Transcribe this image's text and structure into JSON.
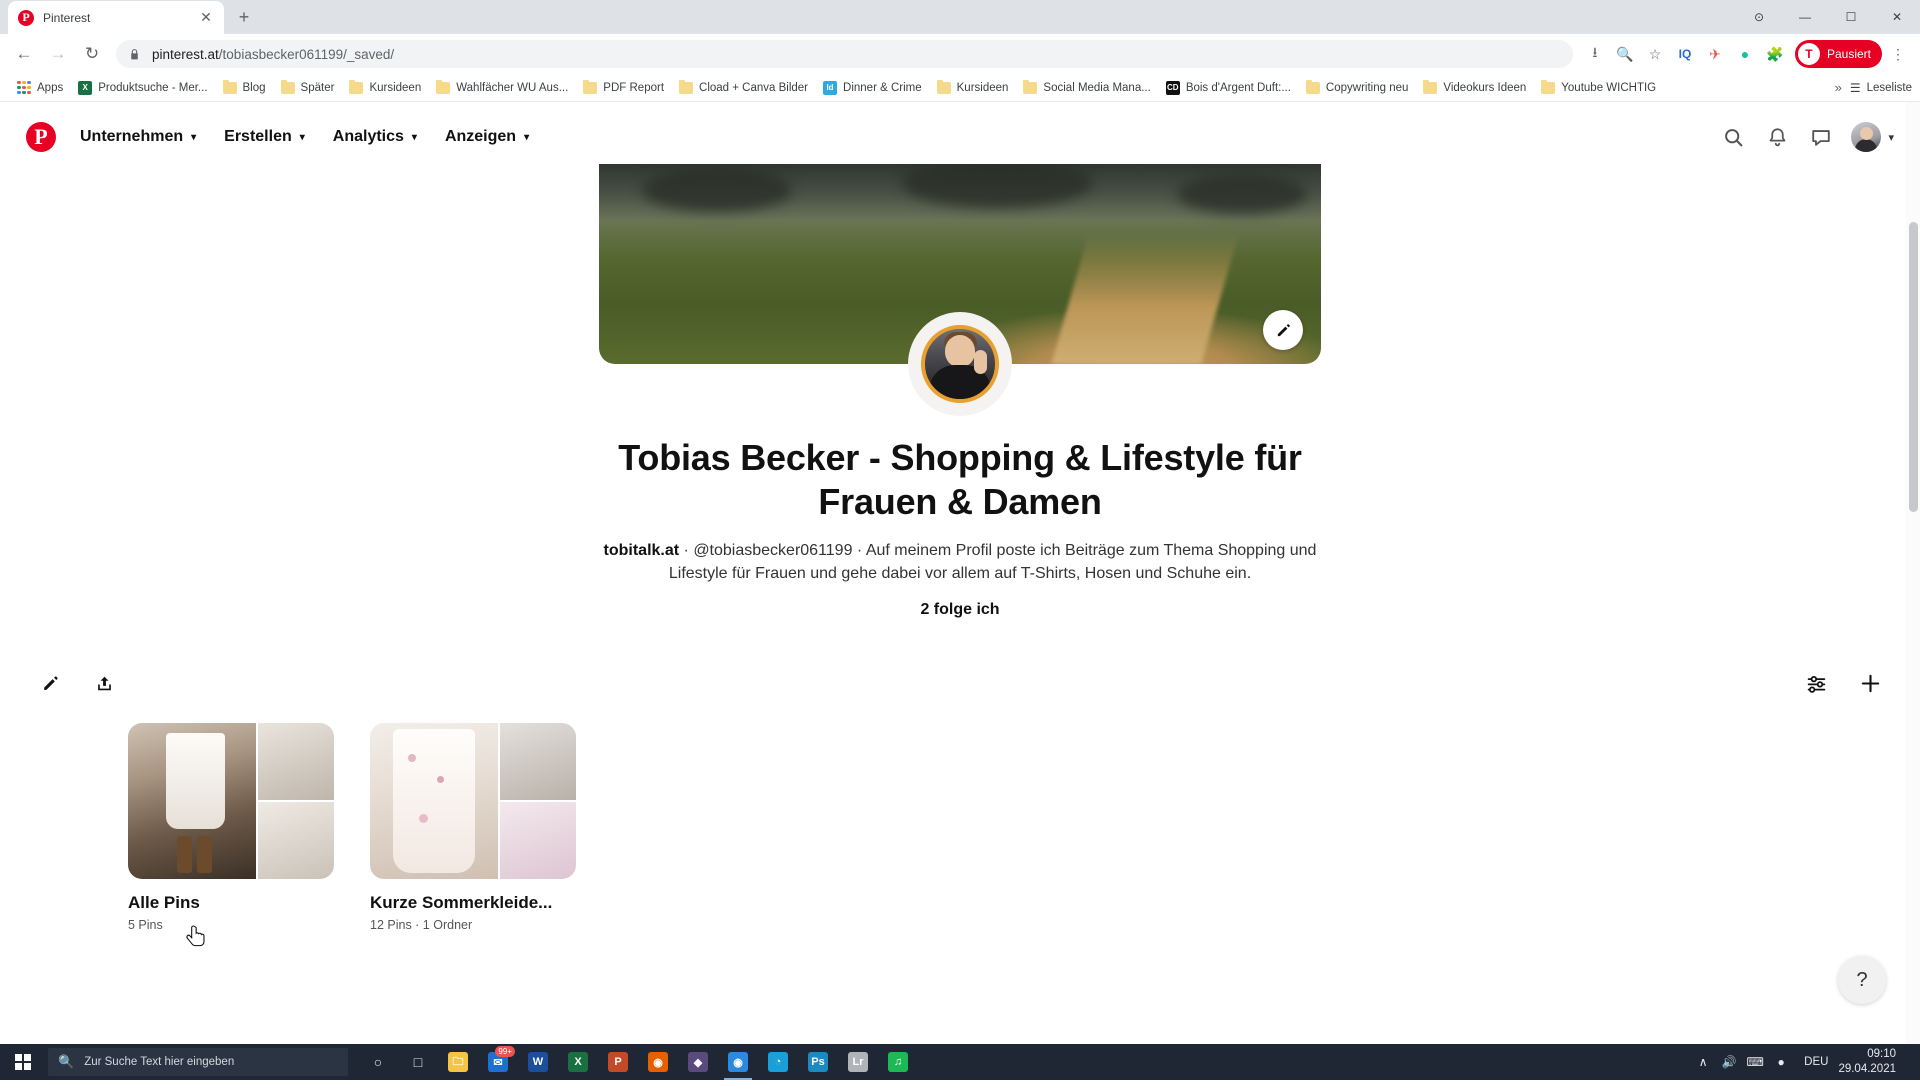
{
  "browser": {
    "tab": {
      "title": "Pinterest",
      "favicon": "pinterest-icon",
      "close_label": "✕"
    },
    "new_tab_label": "+",
    "window_controls": {
      "minimize": "—",
      "maximize": "☐",
      "close": "✕",
      "extra": "⊙"
    },
    "nav": {
      "back": "←",
      "forward": "→",
      "reload": "↻"
    },
    "omnibox": {
      "url_bold": "pinterest.at",
      "url_rest": "/tobiasbecker061199/_saved/",
      "full_url": "pinterest.at/tobiasbecker061199/_saved/",
      "lock_icon": "lock-icon"
    },
    "toolbar_icons": [
      "install-icon",
      "zoom-icon",
      "bookmark-star-icon",
      "iq-extension-icon",
      "extension-icon",
      "grammarly-icon",
      "puzzle-extension-icon"
    ],
    "profile": {
      "initial": "T",
      "label": "Pausiert"
    },
    "menu_icon": "⋮",
    "bookmarks": [
      {
        "label": "Apps",
        "icon": "apps-grid-icon"
      },
      {
        "label": "Produktsuche - Mer...",
        "icon": "excel-icon",
        "color": "#1a7040",
        "glyph": "X"
      },
      {
        "label": "Blog",
        "icon": "folder-icon"
      },
      {
        "label": "Später",
        "icon": "folder-icon"
      },
      {
        "label": "Kursideen",
        "icon": "folder-icon"
      },
      {
        "label": "Wahlfächer WU Aus...",
        "icon": "folder-icon"
      },
      {
        "label": "PDF Report",
        "icon": "folder-icon"
      },
      {
        "label": "Cload + Canva Bilder",
        "icon": "folder-icon"
      },
      {
        "label": "Dinner & Crime",
        "icon": "indesign-icon",
        "color": "#2eaadc",
        "glyph": "Id"
      },
      {
        "label": "Kursideen",
        "icon": "folder-icon"
      },
      {
        "label": "Social Media Mana...",
        "icon": "folder-icon"
      },
      {
        "label": "Bois d'Argent Duft:...",
        "icon": "dior-icon",
        "color": "#111111",
        "glyph": "CD"
      },
      {
        "label": "Copywriting neu",
        "icon": "folder-icon"
      },
      {
        "label": "Videokurs Ideen",
        "icon": "folder-icon"
      },
      {
        "label": "Youtube WICHTIG",
        "icon": "folder-icon"
      }
    ],
    "bookmarks_overflow": "»",
    "reading_list": {
      "label": "Leseliste",
      "icon": "reading-list-icon"
    }
  },
  "pinterest": {
    "logo": "pinterest-logo-icon",
    "nav_items": [
      {
        "label": "Unternehmen",
        "chevron": "▾"
      },
      {
        "label": "Erstellen",
        "chevron": "▾"
      },
      {
        "label": "Analytics",
        "chevron": "▾"
      },
      {
        "label": "Anzeigen",
        "chevron": "▾"
      }
    ],
    "nav_right_icons": [
      "search-icon",
      "bell-icon",
      "chat-icon"
    ],
    "account_chevron": "▾",
    "hero": {
      "edit_icon": "✎",
      "alt": "profile-cover-photo"
    },
    "avatar_alt": "profile-avatar",
    "profile": {
      "title": "Tobias Becker - Shopping & Lifestyle für Frauen & Damen",
      "website": "tobitalk.at",
      "separator": " · ",
      "username": "@tobiasbecker061199",
      "bio": "Auf meinem Profil poste ich Beiträge zum Thema Shopping und Lifestyle für Frauen und gehe dabei vor allem auf T-Shirts, Hosen und Schuhe ein.",
      "following": "2 folge ich"
    },
    "actions": {
      "edit_icon": "✎",
      "share_icon": "↑",
      "filter_icon": "filter-sliders-icon",
      "add_icon": "+"
    },
    "boards": [
      {
        "name": "Alle Pins",
        "meta": "5 Pins"
      },
      {
        "name": "Kurze Sommerkleide...",
        "meta": "12 Pins · 1 Ordner"
      }
    ],
    "help_button": "?"
  },
  "taskbar": {
    "start_icon": "windows-start-icon",
    "search_placeholder": "Zur Suche Text hier eingeben",
    "search_icon": "🔍",
    "items": [
      {
        "name": "cortana-icon",
        "glyph": "○",
        "color": "transparent"
      },
      {
        "name": "task-view-icon",
        "glyph": "□",
        "color": "transparent"
      },
      {
        "name": "file-explorer-icon",
        "glyph": "🗀",
        "color": "#f6c443"
      },
      {
        "name": "mail-icon",
        "glyph": "✉",
        "color": "#1d6fd0",
        "badge": "99+"
      },
      {
        "name": "word-icon",
        "glyph": "W",
        "color": "#1b4e9b"
      },
      {
        "name": "excel-icon",
        "glyph": "X",
        "color": "#1a7040"
      },
      {
        "name": "powerpoint-icon",
        "glyph": "P",
        "color": "#c34a26"
      },
      {
        "name": "firefox-icon",
        "glyph": "◉",
        "color": "#e66000"
      },
      {
        "name": "brave-icon",
        "glyph": "◆",
        "color": "#5a4b7c"
      },
      {
        "name": "chrome-icon",
        "glyph": "◉",
        "color": "#2b8ae0",
        "active": true
      },
      {
        "name": "edge-icon",
        "glyph": "◔",
        "color": "#1aa0d8"
      },
      {
        "name": "photoshop-icon",
        "glyph": "Ps",
        "color": "#1b8ac0"
      },
      {
        "name": "lightroom-icon",
        "glyph": "Lr",
        "color": "#b0b3b8"
      },
      {
        "name": "spotify-icon",
        "glyph": "♫",
        "color": "#1db954"
      }
    ],
    "tray": {
      "chevron": "∧",
      "icons": [
        "volume-icon",
        "keyboard-icon",
        "network-icon"
      ],
      "language": "DEU",
      "time": "09:10",
      "date": "29.04.2021"
    }
  }
}
